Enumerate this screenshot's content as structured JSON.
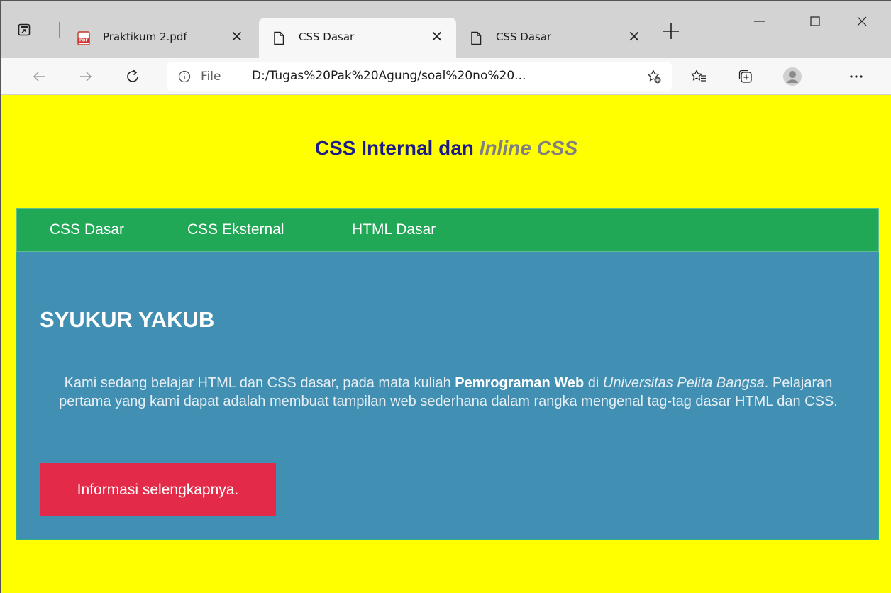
{
  "tabs": [
    {
      "label": "Praktikum 2.pdf",
      "icon": "pdf-icon",
      "active": false
    },
    {
      "label": "CSS Dasar",
      "icon": "page-icon",
      "active": true
    },
    {
      "label": "CSS Dasar",
      "icon": "page-icon",
      "active": false
    }
  ],
  "addressbar": {
    "scheme": "File",
    "url": "D:/Tugas%20Pak%20Agung/soal%20no%20..."
  },
  "page": {
    "title_main": "CSS Internal dan ",
    "title_em": "Inline CSS",
    "nav": [
      "CSS Dasar",
      "CSS Eksternal",
      "HTML Dasar"
    ],
    "heading": "SYUKUR YAKUB",
    "para": {
      "p1": "Kami sedang belajar HTML dan CSS dasar, pada mata kuliah ",
      "bold": "Pemrograman Web",
      "p2": " di ",
      "italic": "Universitas Pelita Bangsa",
      "p3": ". Pelajaran pertama yang kami dapat adalah membuat tampilan web sederhana dalam rangka mengenal tag-tag dasar HTML dan CSS."
    },
    "button": "Informasi selengkapnya."
  },
  "colors": {
    "page_bg": "#ffff00",
    "title": "#1a1a8c",
    "nav_bg": "#21a857",
    "content_bg": "#418fb3",
    "button_bg": "#e32a48"
  }
}
